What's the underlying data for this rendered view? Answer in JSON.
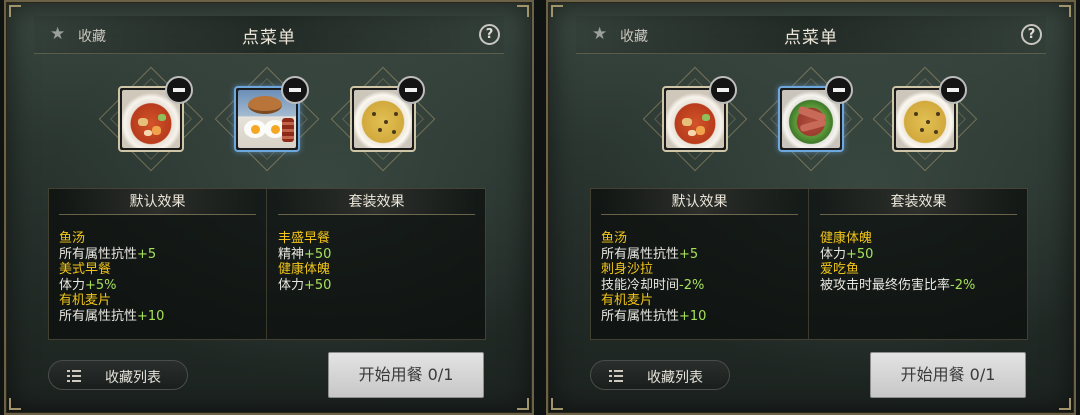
{
  "panels": [
    {
      "favorite_label": "收藏",
      "title": "点菜单",
      "help": "?",
      "dishes": [
        {
          "name": "fish-soup",
          "frame": "gold"
        },
        {
          "name": "american-breakfast",
          "frame": "blue"
        },
        {
          "name": "organic-oats",
          "frame": "gold"
        }
      ],
      "default_effects_header": "默认效果",
      "set_effects_header": "套装效果",
      "default_effects": [
        {
          "name": "鱼汤",
          "stat": "所有属性抗性",
          "value": "+5"
        },
        {
          "name": "美式早餐",
          "stat": "体力",
          "value": "+5%"
        },
        {
          "name": "有机麦片",
          "stat": "所有属性抗性",
          "value": "+10"
        }
      ],
      "set_effects": [
        {
          "name": "丰盛早餐",
          "stat": "精神",
          "value": "+50"
        },
        {
          "name": "健康体魄",
          "stat": "体力",
          "value": "+50"
        }
      ],
      "fav_list_label": "收藏列表",
      "start_label": "开始用餐 0/1"
    },
    {
      "favorite_label": "收藏",
      "title": "点菜单",
      "help": "?",
      "dishes": [
        {
          "name": "fish-soup",
          "frame": "gold"
        },
        {
          "name": "sashimi-salad",
          "frame": "blue"
        },
        {
          "name": "organic-oats",
          "frame": "gold"
        }
      ],
      "default_effects_header": "默认效果",
      "set_effects_header": "套装效果",
      "default_effects": [
        {
          "name": "鱼汤",
          "stat": "所有属性抗性",
          "value": "+5"
        },
        {
          "name": "刺身沙拉",
          "stat": "技能冷却时间",
          "value": "-2%"
        },
        {
          "name": "有机麦片",
          "stat": "所有属性抗性",
          "value": "+10"
        }
      ],
      "set_effects": [
        {
          "name": "健康体魄",
          "stat": "体力",
          "value": "+50"
        },
        {
          "name": "爱吃鱼",
          "stat": "被攻击时最终伤害比率",
          "value": "-2%"
        }
      ],
      "fav_list_label": "收藏列表",
      "start_label": "开始用餐 0/1"
    }
  ],
  "colors": {
    "effect_name": "#f0c419",
    "effect_value": "#a6e05a",
    "frame_gold": "#cfc6a8",
    "frame_blue": "#6ea7dc"
  }
}
